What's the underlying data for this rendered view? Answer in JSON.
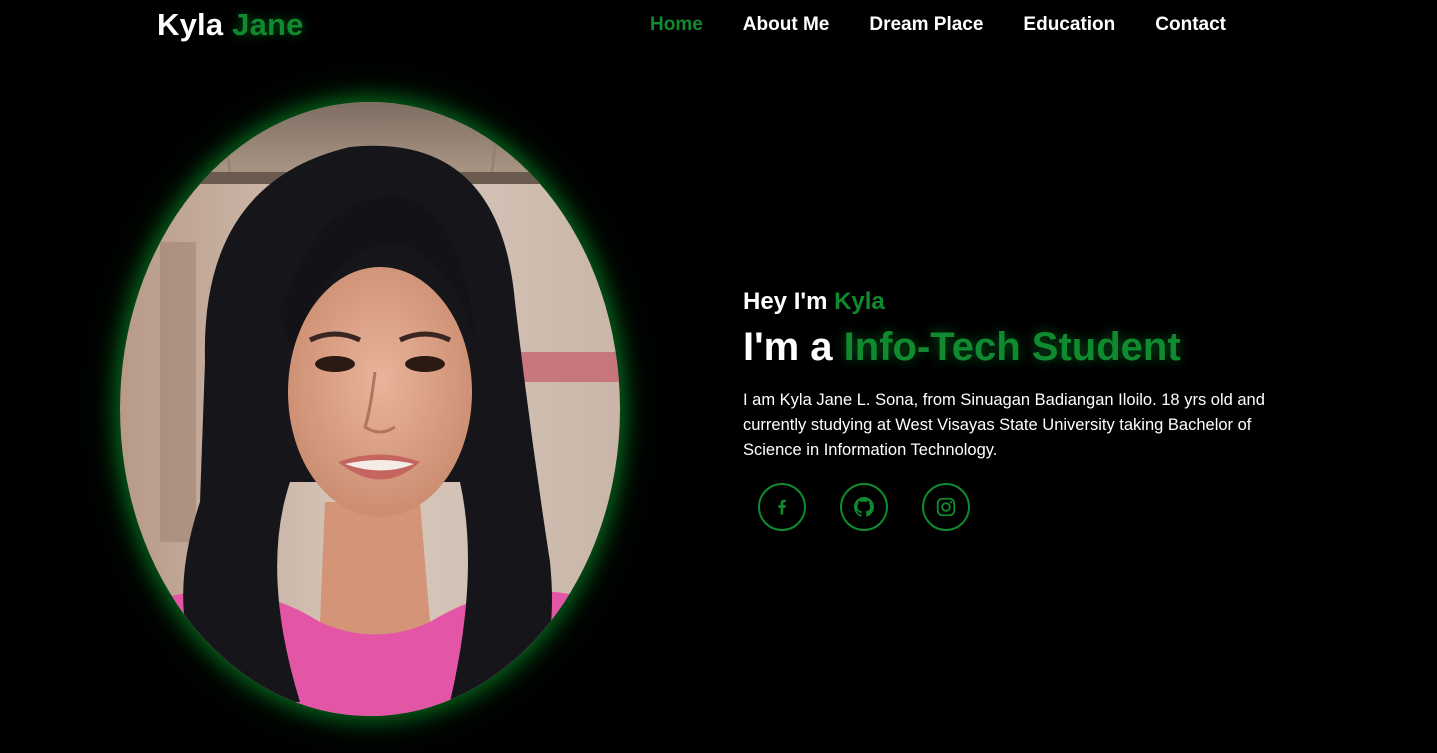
{
  "brand": {
    "first": "Kyla",
    "accent": "Jane"
  },
  "nav": {
    "items": [
      {
        "label": "Home",
        "active": true
      },
      {
        "label": "About Me",
        "active": false
      },
      {
        "label": "Dream Place",
        "active": false
      },
      {
        "label": "Education",
        "active": false
      },
      {
        "label": "Contact",
        "active": false
      }
    ]
  },
  "hero": {
    "greeting_prefix": "Hey I'm ",
    "greeting_name": "Kyla",
    "headline_prefix": "I'm a ",
    "headline_role": "Info-Tech Student",
    "bio": "I am Kyla Jane L. Sona, from Sinuagan Badiangan Iloilo. 18 yrs old and currently studying at West Visayas State University taking Bachelor of Science in Information Technology."
  },
  "socials": [
    {
      "icon": "facebook-icon"
    },
    {
      "icon": "github-icon"
    },
    {
      "icon": "instagram-icon"
    }
  ],
  "colors": {
    "background": "#000000",
    "accent": "#0f8a2e",
    "text": "#ffffff"
  },
  "portrait": {
    "icon": "profile-photo"
  }
}
